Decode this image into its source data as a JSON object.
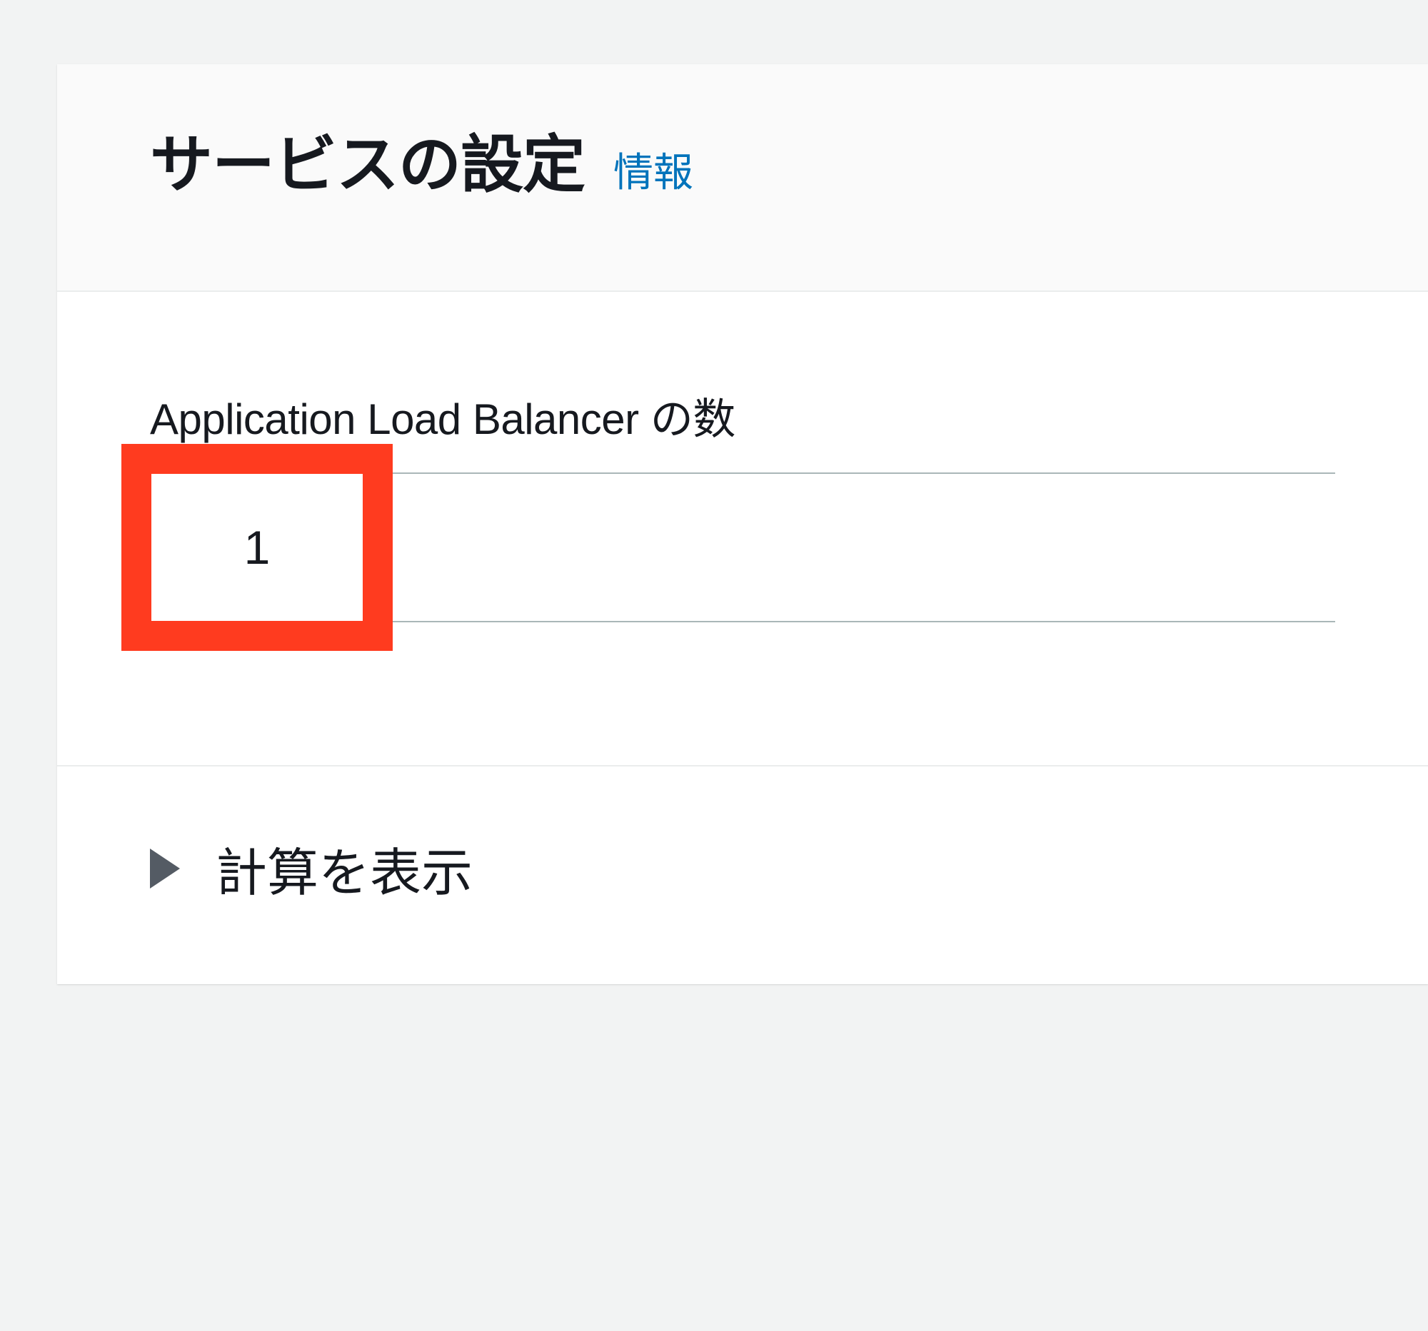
{
  "panel": {
    "title": "サービスの設定",
    "info_label": "情報"
  },
  "field": {
    "label": "Application Load Balancer の数",
    "value": "1"
  },
  "footer": {
    "expand_label": "計算を表示"
  }
}
